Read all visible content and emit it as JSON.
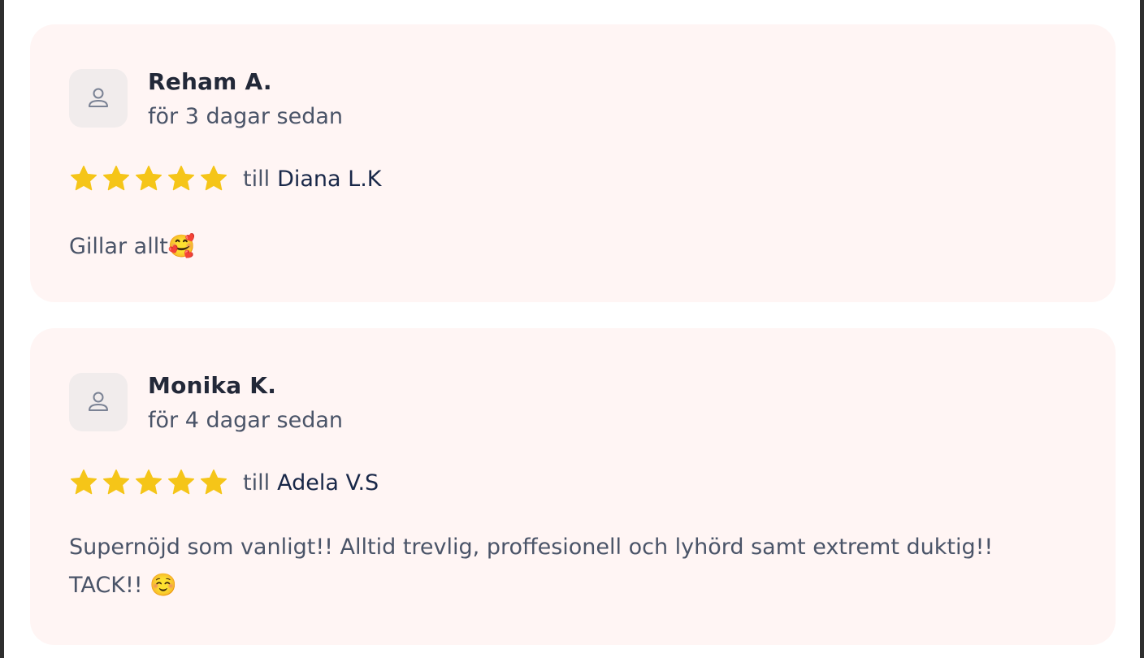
{
  "reviews": [
    {
      "name": "Reham A.",
      "time": "för 3 dagar sedan",
      "rating": 5,
      "till_label": "till",
      "staff": "Diana L.K",
      "text": "Gillar allt🥰"
    },
    {
      "name": "Monika K.",
      "time": "för 4 dagar sedan",
      "rating": 5,
      "till_label": "till",
      "staff": "Adela V.S",
      "text": "Supernöjd som vanligt!! Alltid trevlig, proffesionell och lyhörd samt extremt duktig!! TACK!! ☺️"
    }
  ],
  "icons": {
    "avatar": "user-icon",
    "star": "star-icon"
  },
  "colors": {
    "card_background": "#fff5f4",
    "star": "#f5c518",
    "name": "#222838",
    "body_text": "#4a5468",
    "staff_name": "#182748"
  }
}
